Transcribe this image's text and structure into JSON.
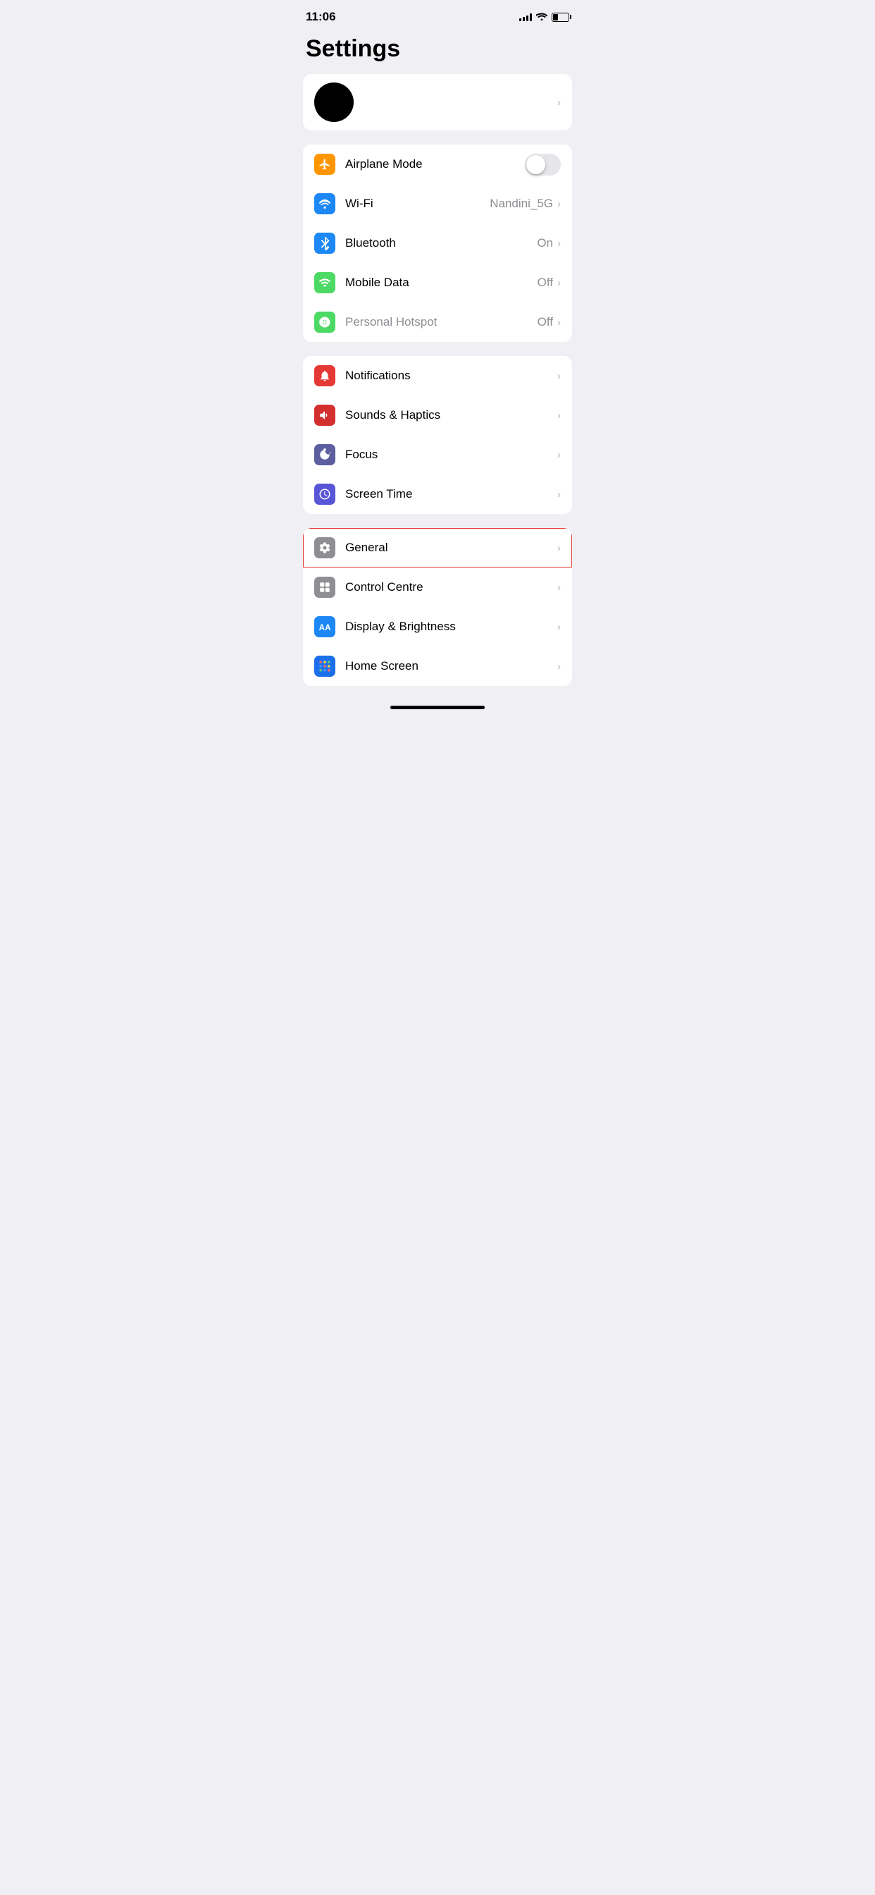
{
  "statusBar": {
    "time": "11:06",
    "signalBars": [
      3,
      5,
      7,
      9,
      11
    ],
    "batteryPercent": 35
  },
  "pageTitle": "Settings",
  "profileItem": {
    "avatarAlt": "Profile photo (redacted)",
    "chevron": "›"
  },
  "networkGroup": [
    {
      "id": "airplane-mode",
      "label": "Airplane Mode",
      "iconColor": "orange",
      "iconType": "airplane",
      "hasToggle": true,
      "toggleOn": false,
      "value": "",
      "chevron": ""
    },
    {
      "id": "wifi",
      "label": "Wi-Fi",
      "iconColor": "blue",
      "iconType": "wifi",
      "hasToggle": false,
      "value": "Nandini_5G",
      "chevron": "›"
    },
    {
      "id": "bluetooth",
      "label": "Bluetooth",
      "iconColor": "blue",
      "iconType": "bluetooth",
      "hasToggle": false,
      "value": "On",
      "chevron": "›"
    },
    {
      "id": "mobile-data",
      "label": "Mobile Data",
      "iconColor": "green",
      "iconType": "cellular",
      "hasToggle": false,
      "value": "Off",
      "chevron": "›"
    },
    {
      "id": "personal-hotspot",
      "label": "Personal Hotspot",
      "iconColor": "green-light",
      "iconType": "hotspot",
      "hasToggle": false,
      "value": "Off",
      "chevron": "›",
      "labelDimmed": true
    }
  ],
  "systemGroup": [
    {
      "id": "notifications",
      "label": "Notifications",
      "iconColor": "red",
      "iconType": "notifications",
      "chevron": "›"
    },
    {
      "id": "sounds-haptics",
      "label": "Sounds & Haptics",
      "iconColor": "red-dark",
      "iconType": "sounds",
      "chevron": "›"
    },
    {
      "id": "focus",
      "label": "Focus",
      "iconColor": "purple",
      "iconType": "focus",
      "chevron": "›"
    },
    {
      "id": "screen-time",
      "label": "Screen Time",
      "iconColor": "purple-screen",
      "iconType": "screentime",
      "chevron": "›"
    }
  ],
  "deviceGroup": [
    {
      "id": "general",
      "label": "General",
      "iconColor": "gray",
      "iconType": "general",
      "chevron": "›",
      "highlighted": true
    },
    {
      "id": "control-centre",
      "label": "Control Centre",
      "iconColor": "gray-control",
      "iconType": "control",
      "chevron": "›"
    },
    {
      "id": "display-brightness",
      "label": "Display & Brightness",
      "iconColor": "blue-aa",
      "iconType": "display",
      "chevron": "›"
    },
    {
      "id": "home-screen",
      "label": "Home Screen",
      "iconColor": "blue-homescreen",
      "iconType": "homescreen",
      "chevron": "›"
    }
  ]
}
